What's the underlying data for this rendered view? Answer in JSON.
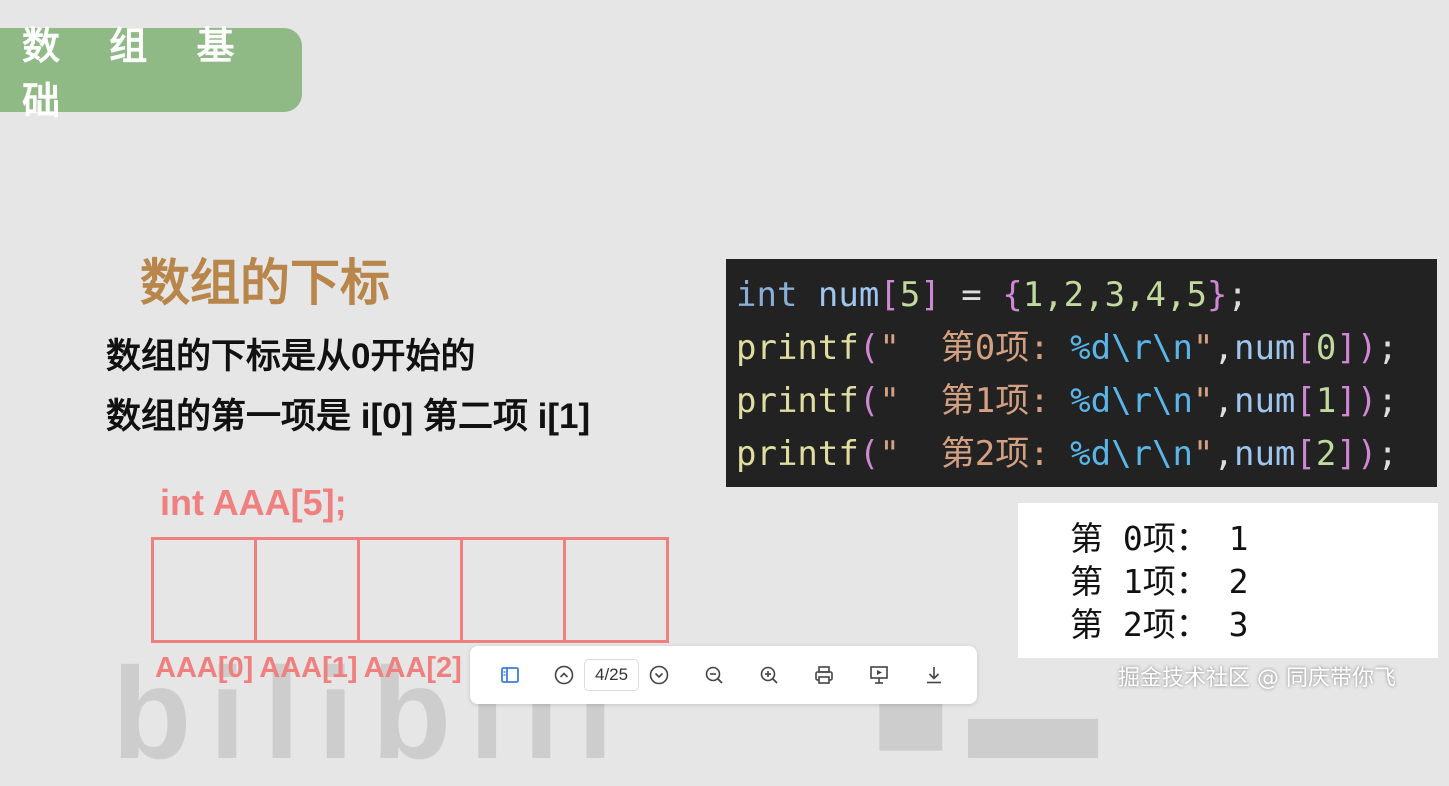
{
  "header": {
    "title": "数 组 基 础"
  },
  "slide": {
    "subtitle": "数组的下标",
    "desc_line1": "数组的下标是从0开始的",
    "desc_line2": "数组的第一项是 i[0] 第二项 i[1]",
    "declaration": "int AAA[5];",
    "cell_labels": [
      "AAA[0]",
      "AAA[1]",
      "AAA[2]"
    ],
    "watermark": "bilibili"
  },
  "code": {
    "line1": {
      "kw": "int",
      "name": "num",
      "size": "5",
      "values": "1,2,3,4,5"
    },
    "printf_lines": [
      {
        "fn": "printf",
        "label": "第0项:",
        "fmt": "%d\\r\\n",
        "index": "0"
      },
      {
        "fn": "printf",
        "label": "第1项:",
        "fmt": "%d\\r\\n",
        "index": "1"
      },
      {
        "fn": "printf",
        "label": "第2项:",
        "fmt": "%d\\r\\n",
        "index": "2"
      }
    ]
  },
  "output": {
    "lines": [
      "第 0项： 1",
      "第 1项： 2",
      "第 2项： 3"
    ]
  },
  "toolbar": {
    "page_indicator": "4/25",
    "buttons": [
      "sidebar-icon",
      "page-up-icon",
      "page-down-icon",
      "zoom-out-icon",
      "zoom-in-icon",
      "print-icon",
      "present-icon",
      "download-icon"
    ]
  },
  "credit": "掘金技术社区 @ 同庆带你飞",
  "colors": {
    "header_bg": "#8fba85",
    "subtitle": "#b8864a",
    "array_red": "#f08080",
    "code_bg": "#222222",
    "toolbar_accent": "#3a7ddc"
  }
}
